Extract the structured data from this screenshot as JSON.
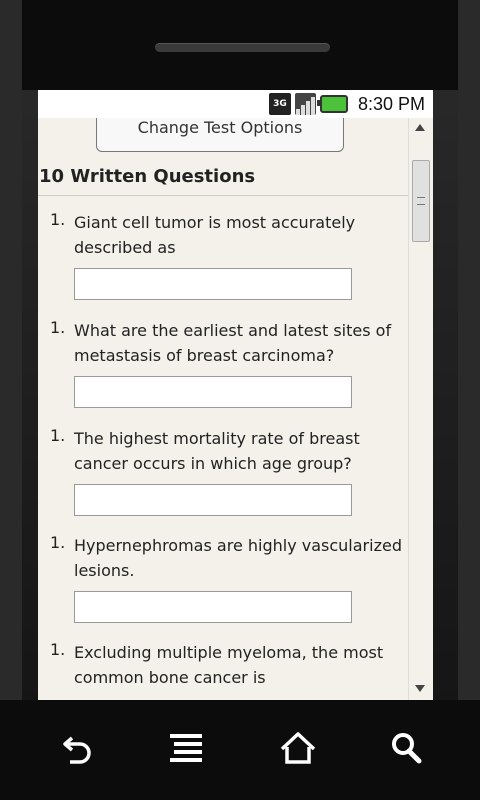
{
  "status_bar": {
    "network_label": "3G",
    "time": "8:30 PM",
    "battery_color": "#4cc23a"
  },
  "page": {
    "change_button_label": "Change Test Options",
    "section_title": "10 Written Questions",
    "questions": [
      {
        "number": "1.",
        "text": "Giant cell tumor is most accurately described as",
        "answer": ""
      },
      {
        "number": "1.",
        "text": "What are the earliest and latest sites of metastasis of breast carcinoma?",
        "answer": ""
      },
      {
        "number": "1.",
        "text": "The highest mortality rate of breast cancer occurs in which age group?",
        "answer": ""
      },
      {
        "number": "1.",
        "text": "Hypernephromas are highly vascularized lesions.",
        "answer": ""
      },
      {
        "number": "1.",
        "text": "Excluding multiple myeloma, the most common bone cancer is",
        "answer": ""
      }
    ]
  },
  "nav": {
    "icons": [
      "back-icon",
      "menu-icon",
      "home-icon",
      "search-icon"
    ]
  }
}
